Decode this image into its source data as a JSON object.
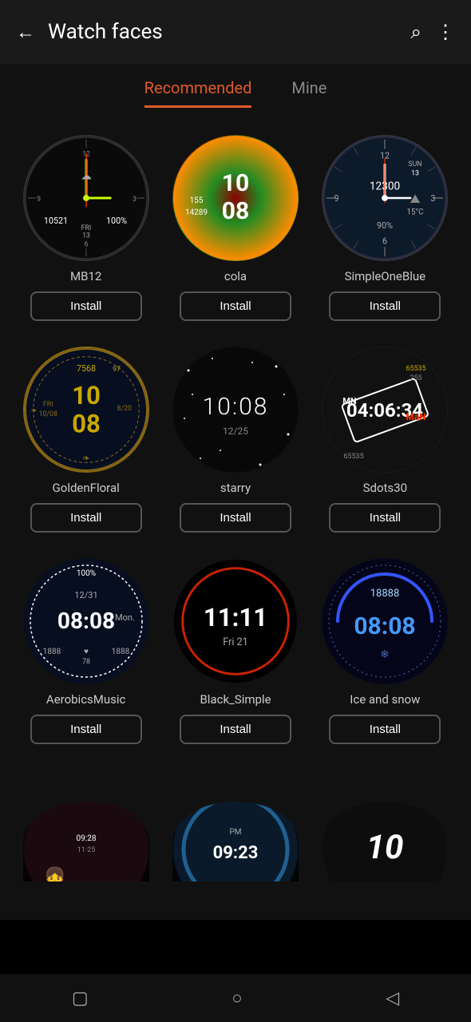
{
  "header": {
    "title": "Watch faces",
    "back_label": "←",
    "search_label": "⌕",
    "more_label": "⋮"
  },
  "tabs": [
    {
      "id": "recommended",
      "label": "Recommended",
      "active": true
    },
    {
      "id": "mine",
      "label": "Mine",
      "active": false
    }
  ],
  "watches": [
    {
      "id": "mb12",
      "name": "MB12",
      "install_label": "Install"
    },
    {
      "id": "cola",
      "name": "cola",
      "install_label": "Install"
    },
    {
      "id": "simple-one-blue",
      "name": "SimpleOneBlue",
      "install_label": "Install"
    },
    {
      "id": "golden-floral",
      "name": "GoldenFloral",
      "install_label": "Install"
    },
    {
      "id": "starry",
      "name": "starry",
      "install_label": "Install"
    },
    {
      "id": "sdots30",
      "name": "Sdots30",
      "install_label": "Install"
    },
    {
      "id": "aerobics-music",
      "name": "AerobicsMusic",
      "install_label": "Install"
    },
    {
      "id": "black-simple",
      "name": "Black_Simple",
      "install_label": "Install"
    },
    {
      "id": "ice-snow",
      "name": "Ice and snow",
      "install_label": "Install"
    }
  ],
  "nav": {
    "square": "▢",
    "circle": "○",
    "back": "◁"
  }
}
